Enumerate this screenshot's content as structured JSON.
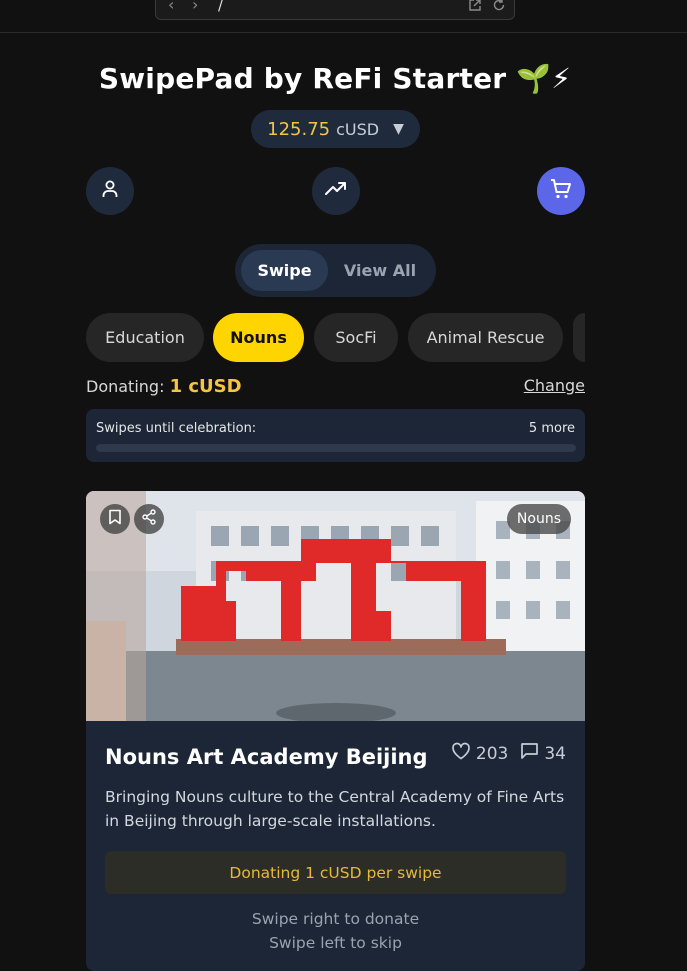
{
  "browser": {
    "path": "/",
    "back_icon": "chevron-left-icon",
    "forward_icon": "chevron-right-icon"
  },
  "app": {
    "title": "SwipePad by ReFi Starter 🌱⚡"
  },
  "balance": {
    "amount": "125.75",
    "currency": "cUSD",
    "caret": "▼"
  },
  "actions": {
    "profile_icon": "user-icon",
    "trending_icon": "trending-up-icon",
    "cart_icon": "cart-icon"
  },
  "view_toggle": {
    "options": [
      "Swipe",
      "View All"
    ],
    "selected": "Swipe"
  },
  "categories": {
    "items": [
      "Education",
      "Nouns",
      "SocFi",
      "Animal Rescue",
      ""
    ],
    "active": "Nouns"
  },
  "donating": {
    "label": "Donating:",
    "value": "1 cUSD",
    "change_label": "Change"
  },
  "celebration": {
    "label": "Swipes until celebration:",
    "remaining": "5 more",
    "progress": 0
  },
  "project": {
    "tag": "Nouns",
    "name": "Nouns Art Academy Beijing",
    "likes": "203",
    "comments": "34",
    "description": "Bringing Nouns culture to the Central Academy of Fine Arts in Beijing through large-scale installations.",
    "donate_note": "Donating 1 cUSD per swipe",
    "hint_right": "Swipe right to donate",
    "hint_left": "Swipe left to skip"
  },
  "colors": {
    "accent_yellow": "#f5c542",
    "chip_active": "#ffd500",
    "cart_blue": "#5b67e8",
    "panel": "#1c2636"
  }
}
